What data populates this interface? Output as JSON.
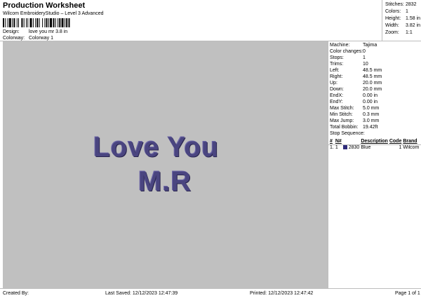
{
  "header": {
    "title": "Production Worksheet",
    "subtitle": "Wilcom EmbroideryStudio – Level 3 Advanced",
    "design_label": "Design:",
    "design_value": "love you mr 3.8 in",
    "colorway_label": "Colorway:",
    "colorway_value": "Colorway 1"
  },
  "stats": [
    {
      "label": "Stitches:",
      "value": "2832"
    },
    {
      "label": "Colors:",
      "value": "1"
    },
    {
      "label": "Height:",
      "value": "1.58 in"
    },
    {
      "label": "Width:",
      "value": "3.82 in"
    },
    {
      "label": "Zoom:",
      "value": "1:1"
    }
  ],
  "canvas": {
    "line1": "Love You",
    "line2": "M.R",
    "thread_color": "#4a4580",
    "background_color": "#c0c0c0"
  },
  "panel": {
    "rows": [
      {
        "label": "Machine:",
        "value": "Tajima"
      },
      {
        "label": "Color changes:",
        "value": "0"
      },
      {
        "label": "Stops:",
        "value": "1"
      },
      {
        "label": "Trims:",
        "value": "10"
      },
      {
        "label": "Left:",
        "value": "48.5 mm"
      },
      {
        "label": "Right:",
        "value": "48.5 mm"
      },
      {
        "label": "Up:",
        "value": "20.0 mm"
      },
      {
        "label": "Down:",
        "value": "20.0 mm"
      },
      {
        "label": "EndX:",
        "value": "0.00 in"
      },
      {
        "label": "EndY:",
        "value": "0.00 in"
      },
      {
        "label": "Max Stitch:",
        "value": "5.0 mm"
      },
      {
        "label": "Min Stitch:",
        "value": "0.3 mm"
      },
      {
        "label": "Max Jump:",
        "value": "3.0 mm"
      },
      {
        "label": "Total Bobbin:",
        "value": "19.42ft"
      }
    ],
    "stop_sequence_label": "Stop Sequence:",
    "stop_table": {
      "headers": [
        "#",
        "N#",
        "",
        "Description",
        "Code",
        "Brand"
      ],
      "rows": [
        {
          "index": "1.",
          "n": "1",
          "stitches": "2830",
          "description": "Blue",
          "code": "1",
          "brand": "Wilcom",
          "swatch_color": "#2f2b7a"
        }
      ]
    }
  },
  "footer": {
    "created_by": "Created By:",
    "last_saved": "Last Saved: 12/12/2023 12:47:39",
    "printed": "Printed: 12/12/2023 12:47:42",
    "page": "Page 1 of 1"
  }
}
